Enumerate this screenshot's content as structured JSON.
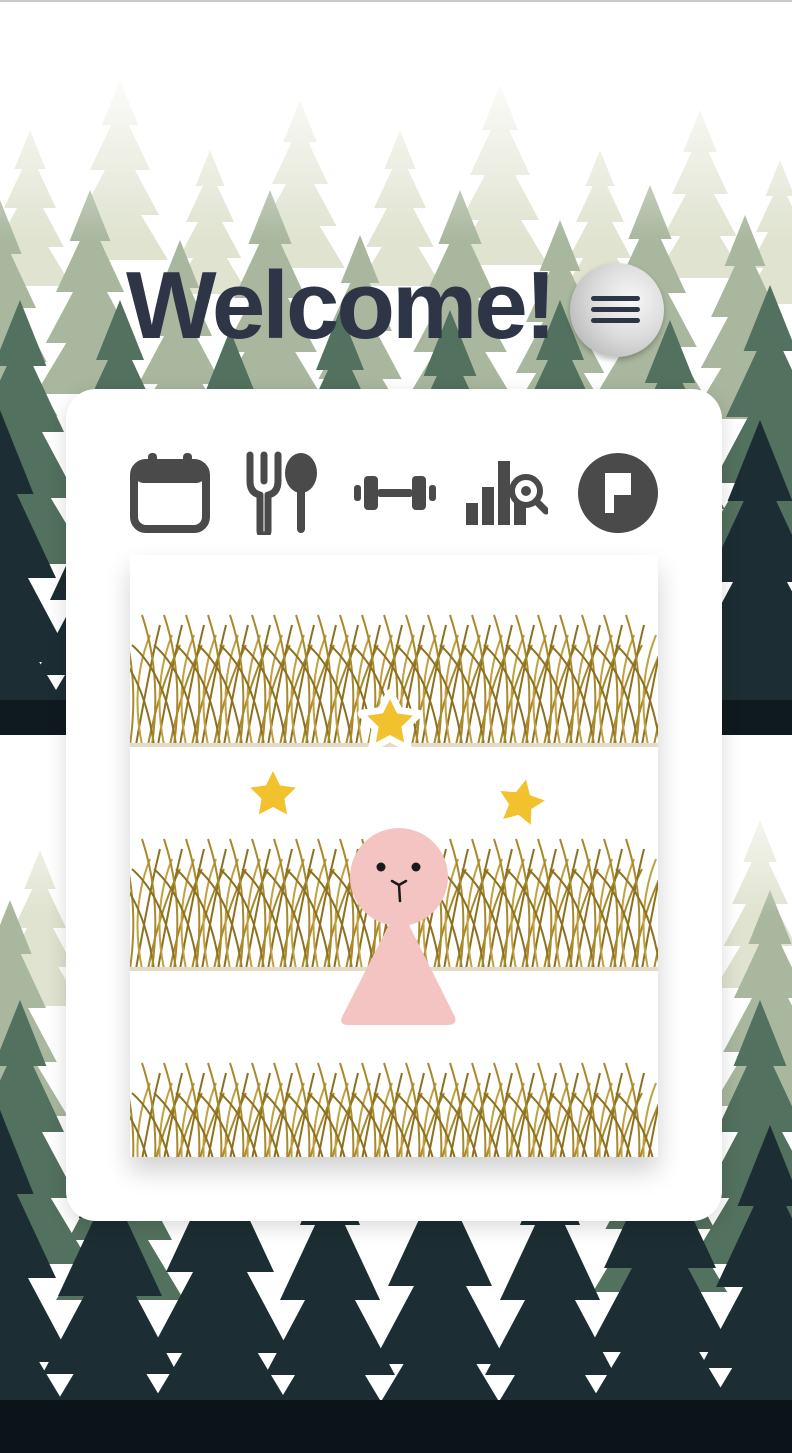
{
  "header": {
    "title": "Welcome!"
  },
  "menu": {
    "icon": "hamburger-menu-icon"
  },
  "nav": {
    "items": [
      {
        "icon": "calendar-icon"
      },
      {
        "icon": "fork-spoon-icon"
      },
      {
        "icon": "dumbbell-icon"
      },
      {
        "icon": "bar-chart-search-icon"
      },
      {
        "icon": "flag-circle-icon"
      }
    ]
  },
  "scene": {
    "character": "pink-creature",
    "stars": 3
  },
  "colors": {
    "title": "#2e3546",
    "icon": "#4a4a4a",
    "star": "#f2c12e",
    "character": "#f4c4c2",
    "grass": "#a88a2c"
  }
}
